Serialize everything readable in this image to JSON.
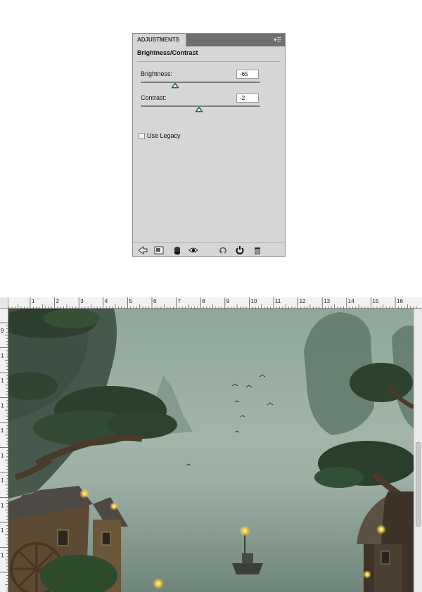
{
  "adjustments_panel": {
    "tab_label": "ADJUSTMENTS",
    "menu_icon": "panel-menu-icon",
    "title": "Brightness/Contrast",
    "brightness": {
      "label": "Brightness:",
      "value": "-65",
      "slider_level": 0.29
    },
    "contrast": {
      "label": "Contrast:",
      "value": "-2",
      "slider_level": 0.49
    },
    "use_legacy": {
      "label": "Use Legacy",
      "checked": false
    },
    "toolbar_icons": [
      "back-arrow-icon",
      "expand-view-icon",
      "clip-layer-icon",
      "visibility-eye-icon",
      "previous-state-icon",
      "reset-icon",
      "delete-icon"
    ]
  },
  "document": {
    "ruler_top_labels": [
      "1",
      "2",
      "3",
      "4",
      "5",
      "6",
      "7",
      "8",
      "9",
      "10",
      "11",
      "12",
      "13",
      "14",
      "15",
      "16"
    ],
    "ruler_left_labels": [
      "9",
      "1",
      "1",
      "1",
      "1",
      "1",
      "1",
      "1",
      "1",
      "1"
    ],
    "scene": "fantasy-landscape"
  }
}
